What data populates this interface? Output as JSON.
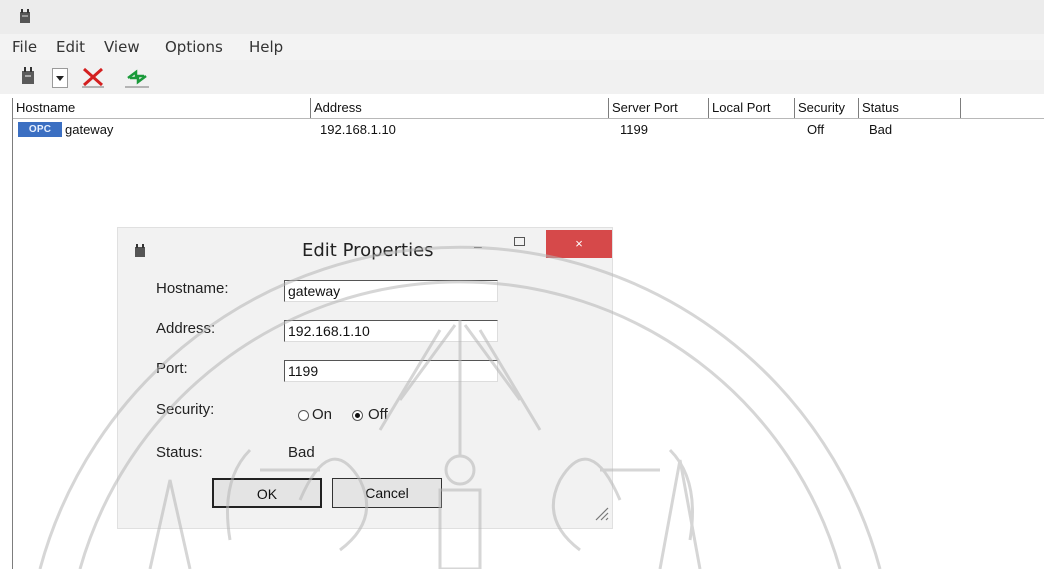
{
  "window": {
    "title": "",
    "icon": "plug-server-icon"
  },
  "menu": [
    "File",
    "Edit",
    "View",
    "Options",
    "Help"
  ],
  "toolbar": [
    {
      "name": "add-server",
      "icon": "plug-server-icon",
      "has_dropdown": true
    },
    {
      "name": "delete",
      "icon": "red-x-icon"
    },
    {
      "name": "refresh",
      "icon": "green-arrows-icon"
    }
  ],
  "table": {
    "columns": [
      "Hostname",
      "Address",
      "Server Port",
      "Local Port",
      "Security",
      "Status"
    ],
    "rows": [
      {
        "badge": "OPC",
        "hostname": "gateway",
        "address": "192.168.1.10",
        "server_port": "1199",
        "local_port": "",
        "security": "Off",
        "status": "Bad"
      }
    ]
  },
  "dialog": {
    "title": "Edit Properties",
    "close_glyph": "×",
    "labels": {
      "hostname": "Hostname:",
      "address": "Address:",
      "port": "Port:",
      "security": "Security:",
      "status": "Status:"
    },
    "values": {
      "hostname": "gateway",
      "address": "192.168.1.10",
      "port": "1199",
      "status": "Bad"
    },
    "security_options": [
      "On",
      "Off"
    ],
    "security_selected": "Off",
    "buttons": {
      "ok": "OK",
      "cancel": "Cancel"
    }
  },
  "colors": {
    "close_button": "#d6494a",
    "opc_badge": "#3b6fc2",
    "watermark": "#b5b5b5"
  }
}
